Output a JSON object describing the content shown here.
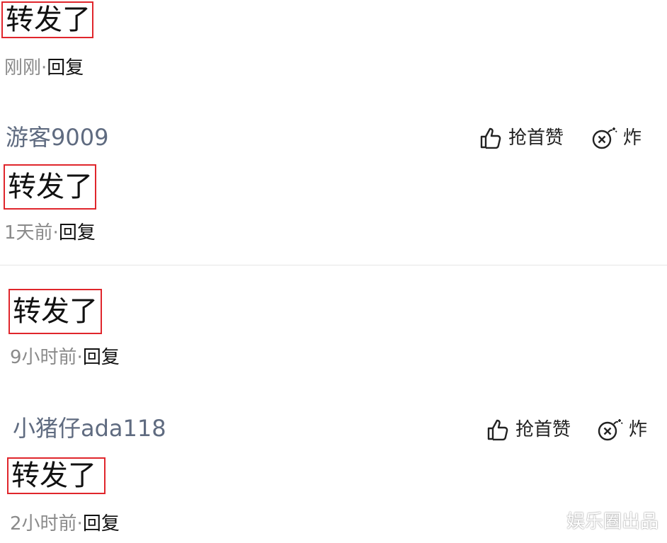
{
  "comments": [
    {
      "username": "",
      "text": "转发了",
      "time": "刚刚",
      "separator": "·",
      "reply_label": "回复"
    },
    {
      "username": "游客9009",
      "text": "转发了",
      "time": "1天前",
      "separator": "·",
      "reply_label": "回复",
      "like_label": "抢首赞",
      "bomb_label": "炸"
    },
    {
      "username": "",
      "text": "转发了",
      "time": "9小时前",
      "separator": "·",
      "reply_label": "回复"
    },
    {
      "username": "小猪仔ada118",
      "text": "转发了",
      "time": "2小时前",
      "separator": "·",
      "reply_label": "回复",
      "like_label": "抢首赞",
      "bomb_label": "炸"
    }
  ],
  "icons": {
    "like": "thumbs-up-icon",
    "bomb": "bomb-icon"
  },
  "colors": {
    "highlight_border": "#e0262c",
    "username": "#5f6b80",
    "meta": "#8a8a8a"
  },
  "watermark": "娱乐圈出品"
}
